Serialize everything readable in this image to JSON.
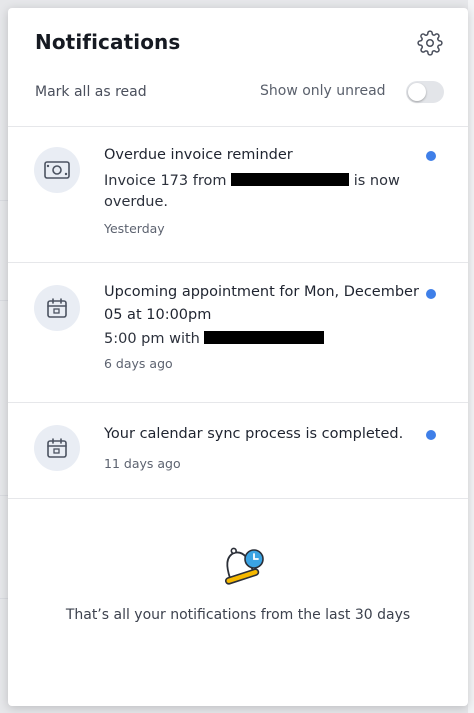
{
  "header": {
    "title": "Notifications",
    "settings_icon": "gear-icon",
    "mark_all_label": "Mark all as read",
    "show_unread_label": "Show only unread",
    "show_unread_enabled": false
  },
  "notifications": [
    {
      "icon": "money-icon",
      "title": "Overdue invoice reminder",
      "body_prefix": "Invoice 173 from",
      "body_suffix": "is now overdue.",
      "time": "Yesterday",
      "unread": true
    },
    {
      "icon": "calendar-icon",
      "title": "Upcoming appointment for Mon, December 05 at 10:00pm",
      "body_prefix": "5:00 pm with",
      "body_suffix": "",
      "time": "6 days ago",
      "unread": true
    },
    {
      "icon": "calendar-icon",
      "title": "Your calendar sync process is completed.",
      "time": "11 days ago",
      "unread": true
    }
  ],
  "footer": {
    "icon": "bell-clock-icon",
    "text": "That’s all your notifications from the last 30 days"
  },
  "colors": {
    "unread_dot": "#3f7fe8",
    "icon_bg": "#e9edf4",
    "bell_yellow": "#f5b800",
    "clock_blue": "#3aa3e3"
  }
}
